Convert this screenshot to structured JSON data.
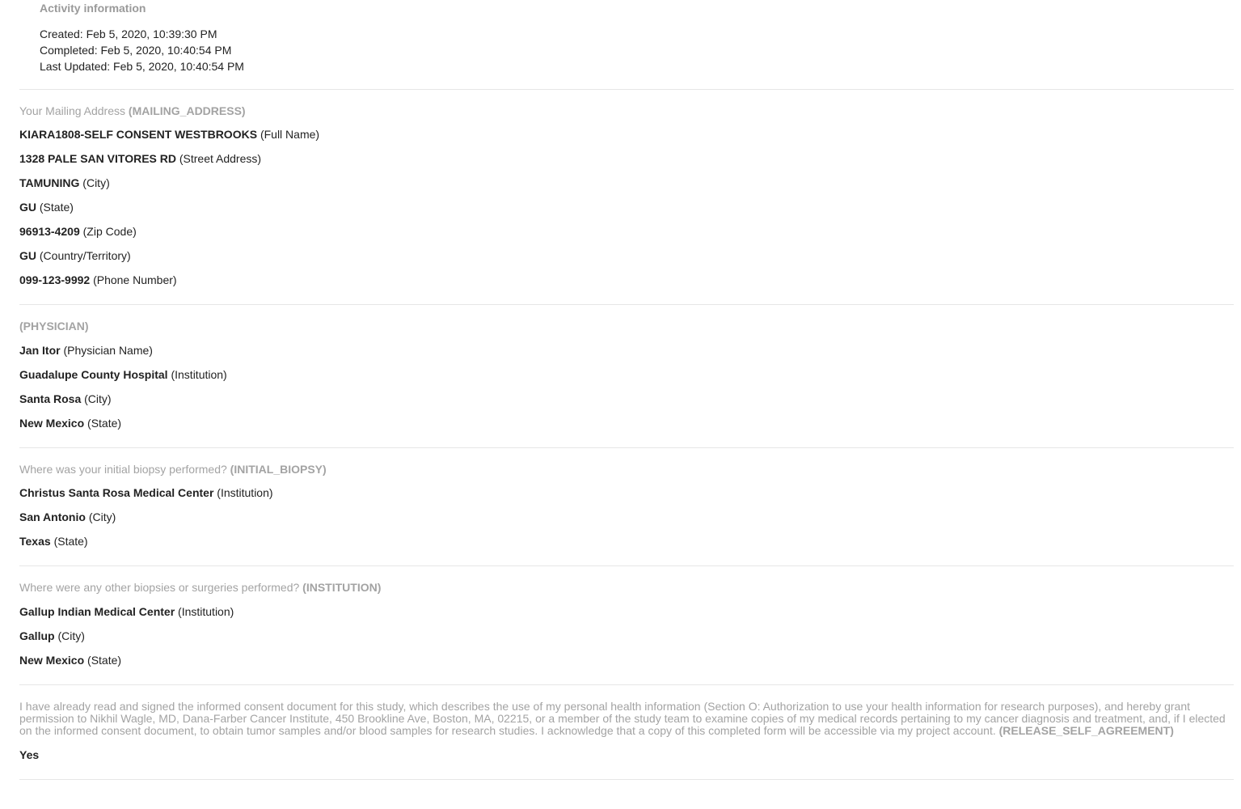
{
  "activity": {
    "title": "Activity information",
    "created": "Created: Feb 5, 2020, 10:39:30 PM",
    "completed": "Completed: Feb 5, 2020, 10:40:54 PM",
    "last_updated": "Last Updated: Feb 5, 2020, 10:40:54 PM"
  },
  "mailing": {
    "question": "Your Mailing Address",
    "key": "(MAILING_ADDRESS)",
    "answers": [
      {
        "value": "KIARA1808-SELF CONSENT WESTBROOKS",
        "label": "(Full Name)"
      },
      {
        "value": "1328 PALE SAN VITORES RD",
        "label": "(Street Address)"
      },
      {
        "value": "TAMUNING",
        "label": "(City)"
      },
      {
        "value": "GU",
        "label": "(State)"
      },
      {
        "value": "96913-4209",
        "label": "(Zip Code)"
      },
      {
        "value": "GU",
        "label": "(Country/Territory)"
      },
      {
        "value": "099-123-9992",
        "label": "(Phone Number)"
      }
    ]
  },
  "physician": {
    "question": "",
    "key": "(PHYSICIAN)",
    "answers": [
      {
        "value": "Jan Itor",
        "label": "(Physician Name)"
      },
      {
        "value": "Guadalupe County Hospital",
        "label": "(Institution)"
      },
      {
        "value": "Santa Rosa",
        "label": "(City)"
      },
      {
        "value": "New Mexico",
        "label": "(State)"
      }
    ]
  },
  "initial_biopsy": {
    "question": "Where was your initial biopsy performed?",
    "key": "(INITIAL_BIOPSY)",
    "answers": [
      {
        "value": "Christus Santa Rosa Medical Center",
        "label": "(Institution)"
      },
      {
        "value": "San Antonio",
        "label": "(City)"
      },
      {
        "value": "Texas",
        "label": "(State)"
      }
    ]
  },
  "institution": {
    "question": "Where were any other biopsies or surgeries performed?",
    "key": "(INSTITUTION)",
    "answers": [
      {
        "value": "Gallup Indian Medical Center",
        "label": "(Institution)"
      },
      {
        "value": "Gallup",
        "label": "(City)"
      },
      {
        "value": "New Mexico",
        "label": "(State)"
      }
    ]
  },
  "release": {
    "question": "I have already read and signed the informed consent document for this study, which describes the use of my personal health information (Section O: Authorization to use your health information for research purposes), and hereby grant permission to Nikhil Wagle, MD, Dana-Farber Cancer Institute, 450 Brookline Ave, Boston, MA, 02215, or a member of the study team to examine copies of my medical records pertaining to my cancer diagnosis and treatment, and, if I elected on the informed consent document, to obtain tumor samples and/or blood samples for research studies. I acknowledge that a copy of this completed form will be accessible via my project account.",
    "key": "(RELEASE_SELF_AGREEMENT)",
    "answer": "Yes"
  }
}
